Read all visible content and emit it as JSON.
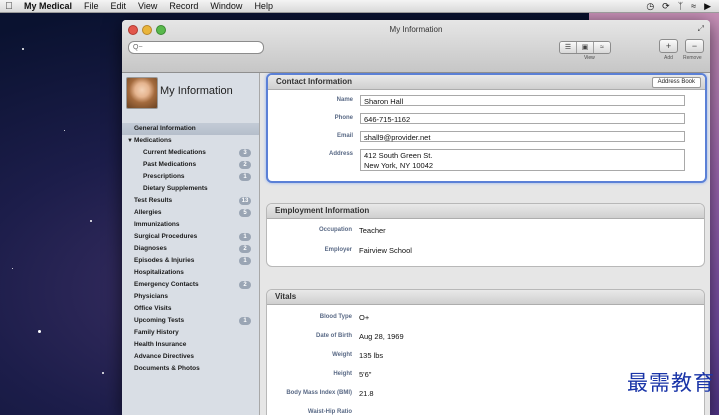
{
  "menubar": {
    "app_name": "My Medical",
    "menus": [
      "File",
      "Edit",
      "View",
      "Record",
      "Window",
      "Help"
    ],
    "status_icons": [
      "time-machine-icon",
      "sync-icon",
      "bluetooth-icon",
      "wifi-icon",
      "volume-icon"
    ]
  },
  "window": {
    "title": "My Information",
    "search_placeholder": "Q−",
    "view_label": "View",
    "add_label": "Add",
    "remove_label": "Remove"
  },
  "sidebar": {
    "title": "My Information",
    "items": [
      {
        "label": "General Information",
        "selected": true,
        "level": 0
      },
      {
        "label": "Medications",
        "level": 0,
        "expanded": true
      },
      {
        "label": "Current Medications",
        "level": 1,
        "badge": "3"
      },
      {
        "label": "Past Medications",
        "level": 1,
        "badge": "2"
      },
      {
        "label": "Prescriptions",
        "level": 1,
        "badge": "1"
      },
      {
        "label": "Dietary Supplements",
        "level": 1
      },
      {
        "label": "Test Results",
        "level": 0,
        "badge": "13"
      },
      {
        "label": "Allergies",
        "level": 0,
        "badge": "5"
      },
      {
        "label": "Immunizations",
        "level": 0
      },
      {
        "label": "Surgical Procedures",
        "level": 0,
        "badge": "1"
      },
      {
        "label": "Diagnoses",
        "level": 0,
        "badge": "2"
      },
      {
        "label": "Episodes & Injuries",
        "level": 0,
        "badge": "1"
      },
      {
        "label": "Hospitalizations",
        "level": 0
      },
      {
        "label": "Emergency Contacts",
        "level": 0,
        "badge": "2"
      },
      {
        "label": "Physicians",
        "level": 0
      },
      {
        "label": "Office Visits",
        "level": 0
      },
      {
        "label": "Upcoming Tests",
        "level": 0,
        "badge": "1"
      },
      {
        "label": "Family History",
        "level": 0
      },
      {
        "label": "Health Insurance",
        "level": 0
      },
      {
        "label": "Advance Directives",
        "level": 0
      },
      {
        "label": "Documents & Photos",
        "level": 0
      }
    ]
  },
  "contact": {
    "header": "Contact Information",
    "address_book_label": "Address Book",
    "name_label": "Name",
    "name": "Sharon Hall",
    "phone_label": "Phone",
    "phone": "646-715-1162",
    "email_label": "Email",
    "email": "shall9@provider.net",
    "address_label": "Address",
    "address_line1": "412 South Green St.",
    "address_line2": "New York, NY 10042"
  },
  "employment": {
    "header": "Employment Information",
    "occupation_label": "Occupation",
    "occupation": "Teacher",
    "employer_label": "Employer",
    "employer": "Fairview School"
  },
  "vitals": {
    "header": "Vitals",
    "blood_type_label": "Blood Type",
    "blood_type": "O+",
    "dob_label": "Date of Birth",
    "dob": "Aug 28, 1969",
    "weight_label": "Weight",
    "weight": "135 lbs",
    "height_label": "Height",
    "height": "5'6\"",
    "bmi_label": "Body Mass Index (BMI)",
    "bmi": "21.8",
    "whr_label": "Waist-Hip Ratio"
  },
  "watermark": "最需教育"
}
